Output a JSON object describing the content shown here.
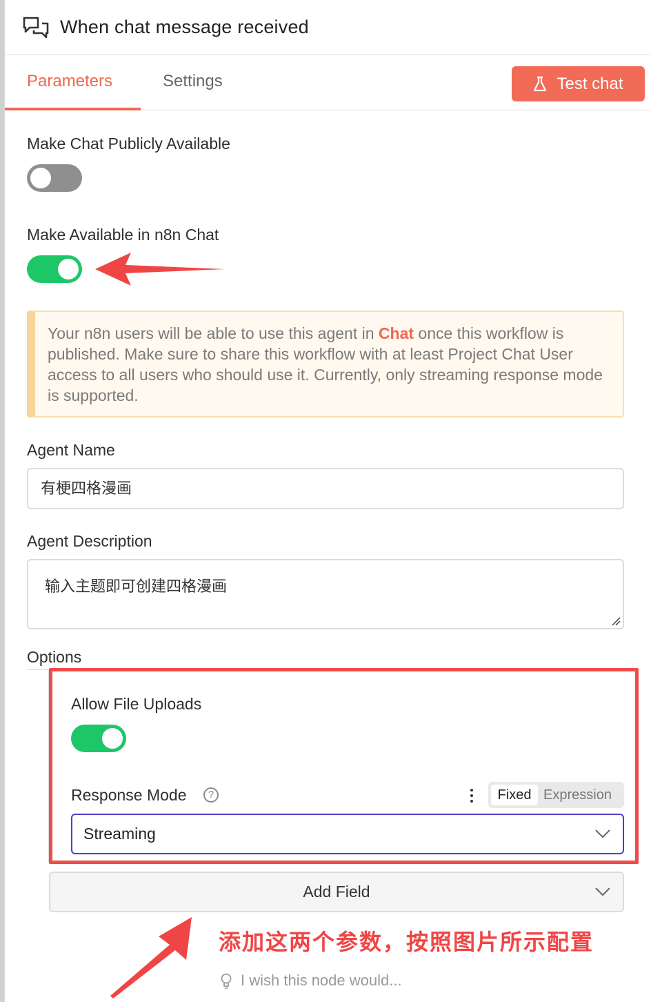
{
  "header": {
    "title": "When chat message received",
    "icon": "chat-bubbles-icon"
  },
  "tabs": {
    "parameters": "Parameters",
    "settings": "Settings",
    "test_chat": "Test chat",
    "test_icon": "flask-icon"
  },
  "params": {
    "public_label": "Make Chat Publicly Available",
    "public_enabled": false,
    "n8n_chat_label": "Make Available in n8n Chat",
    "n8n_chat_enabled": true,
    "notice_before": "Your n8n users will be able to use this agent in ",
    "notice_link": "Chat",
    "notice_after": " once this workflow is published. Make sure to share this workflow with at least Project Chat User access to all users who should use it. Currently, only streaming response mode is supported.",
    "agent_name_label": "Agent Name",
    "agent_name_value": "有梗四格漫画",
    "agent_desc_label": "Agent Description",
    "agent_desc_value": "输入主题即可创建四格漫画",
    "options_label": "Options",
    "file_uploads_label": "Allow File Uploads",
    "file_uploads_enabled": true,
    "response_mode_label": "Response Mode",
    "help_glyph": "?",
    "mode_fixed": "Fixed",
    "mode_expression": "Expression",
    "response_mode_value": "Streaming",
    "add_field": "Add Field"
  },
  "annotation": {
    "text": "添加这两个参数，按照图片所示配置"
  },
  "footer": {
    "wish": "I wish this node would..."
  },
  "colors": {
    "accent": "#f1674f",
    "toggle_on": "#1dc767",
    "annotation": "#f04545",
    "select_border": "#4f3ec6"
  }
}
